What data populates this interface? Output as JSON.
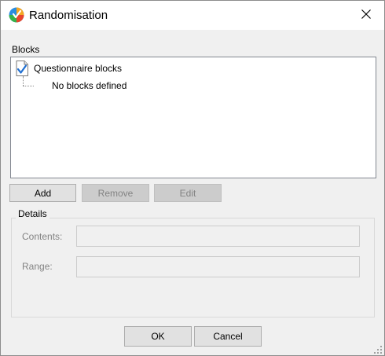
{
  "window": {
    "title": "Randomisation",
    "app_icon": "app-logo-icon",
    "close_icon": "close-icon"
  },
  "blocks": {
    "label": "Blocks",
    "tree": {
      "root": {
        "label": "Questionnaire blocks",
        "icon": "checked-document-icon"
      },
      "children": [
        {
          "label": "No blocks defined"
        }
      ]
    },
    "buttons": {
      "add": "Add",
      "remove": "Remove",
      "edit": "Edit"
    }
  },
  "details": {
    "label": "Details",
    "contents": {
      "label": "Contents:",
      "value": ""
    },
    "range": {
      "label": "Range:",
      "value": ""
    }
  },
  "footer": {
    "ok": "OK",
    "cancel": "Cancel"
  }
}
